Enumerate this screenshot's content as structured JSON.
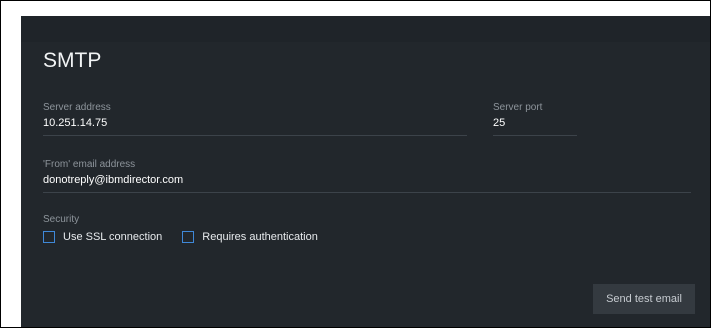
{
  "section": {
    "title": "SMTP"
  },
  "fields": {
    "server_address": {
      "label": "Server address",
      "value": "10.251.14.75"
    },
    "server_port": {
      "label": "Server port",
      "value": "25"
    },
    "from_email": {
      "label": "'From' email address",
      "value": "donotreply@ibmdirector.com"
    }
  },
  "security": {
    "label": "Security",
    "options": [
      {
        "label": "Use SSL connection",
        "checked": false
      },
      {
        "label": "Requires authentication",
        "checked": false
      }
    ]
  },
  "actions": {
    "send_test_email": "Send test email"
  },
  "colors": {
    "panel_bg": "#22272c",
    "checkbox_border": "#3f88d8",
    "button_bg": "#343a40"
  }
}
